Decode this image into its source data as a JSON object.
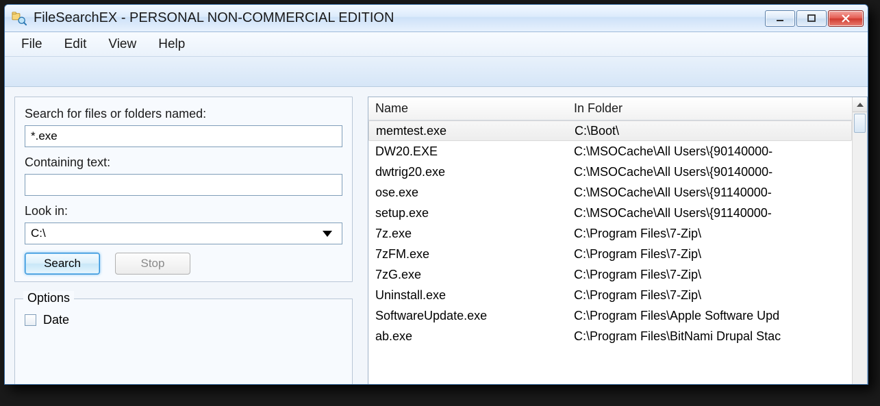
{
  "window": {
    "title": "FileSearchEX - PERSONAL NON-COMMERCIAL EDITION"
  },
  "menubar": {
    "file": "File",
    "edit": "Edit",
    "view": "View",
    "help": "Help"
  },
  "searchPanel": {
    "searchForLabel": "Search for files or folders named:",
    "searchForValue": "*.exe",
    "containingLabel": "Containing text:",
    "containingValue": "",
    "lookInLabel": "Look in:",
    "lookInValue": "C:\\",
    "searchBtn": "Search",
    "stopBtn": "Stop",
    "optionsLegend": "Options",
    "dateLabel": "Date"
  },
  "results": {
    "colName": "Name",
    "colFolder": "In Folder",
    "rows": [
      {
        "name": "memtest.exe",
        "folder": "C:\\Boot\\"
      },
      {
        "name": "DW20.EXE",
        "folder": "C:\\MSOCache\\All Users\\{90140000-"
      },
      {
        "name": "dwtrig20.exe",
        "folder": "C:\\MSOCache\\All Users\\{90140000-"
      },
      {
        "name": "ose.exe",
        "folder": "C:\\MSOCache\\All Users\\{91140000-"
      },
      {
        "name": "setup.exe",
        "folder": "C:\\MSOCache\\All Users\\{91140000-"
      },
      {
        "name": "7z.exe",
        "folder": "C:\\Program Files\\7-Zip\\"
      },
      {
        "name": "7zFM.exe",
        "folder": "C:\\Program Files\\7-Zip\\"
      },
      {
        "name": "7zG.exe",
        "folder": "C:\\Program Files\\7-Zip\\"
      },
      {
        "name": "Uninstall.exe",
        "folder": "C:\\Program Files\\7-Zip\\"
      },
      {
        "name": "SoftwareUpdate.exe",
        "folder": "C:\\Program Files\\Apple Software Upd"
      },
      {
        "name": "ab.exe",
        "folder": "C:\\Program Files\\BitNami Drupal Stac"
      }
    ]
  }
}
